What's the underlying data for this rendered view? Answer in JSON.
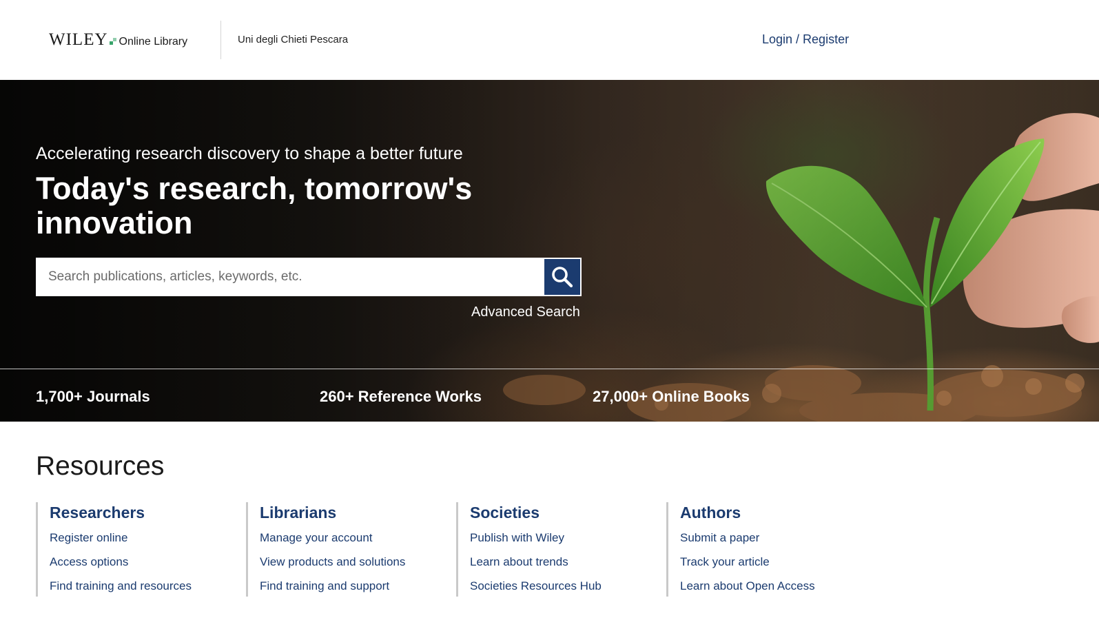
{
  "header": {
    "logo_wordmark": "WILEY",
    "logo_suffix": "Online Library",
    "institution": "Uni degli Chieti Pescara",
    "login_label": "Login / Register"
  },
  "hero": {
    "tagline": "Accelerating research discovery to shape a better future",
    "title": "Today's research, tomorrow's innovation",
    "search_placeholder": "Search publications, articles, keywords, etc.",
    "search_value": "",
    "advanced_search_label": "Advanced Search",
    "stats": [
      "1,700+ Journals",
      "260+ Reference Works",
      "27,000+ Online Books"
    ]
  },
  "resources": {
    "title": "Resources",
    "columns": [
      {
        "heading": "Researchers",
        "links": [
          "Register online",
          "Access options",
          "Find training and resources"
        ]
      },
      {
        "heading": "Librarians",
        "links": [
          "Manage your account",
          "View products and solutions",
          "Find training and support"
        ]
      },
      {
        "heading": "Societies",
        "links": [
          "Publish with Wiley",
          "Learn about trends",
          "Societies Resources Hub"
        ]
      },
      {
        "heading": "Authors",
        "links": [
          "Submit a paper",
          "Track your article",
          "Learn about Open Access"
        ]
      }
    ]
  },
  "colors": {
    "brand_navy": "#1b3b6f",
    "logo_green": "#37a46a",
    "hero_text": "#ffffff"
  },
  "icons": {
    "search_button": "search-icon",
    "logo_mark": "wiley-dot-icon"
  }
}
